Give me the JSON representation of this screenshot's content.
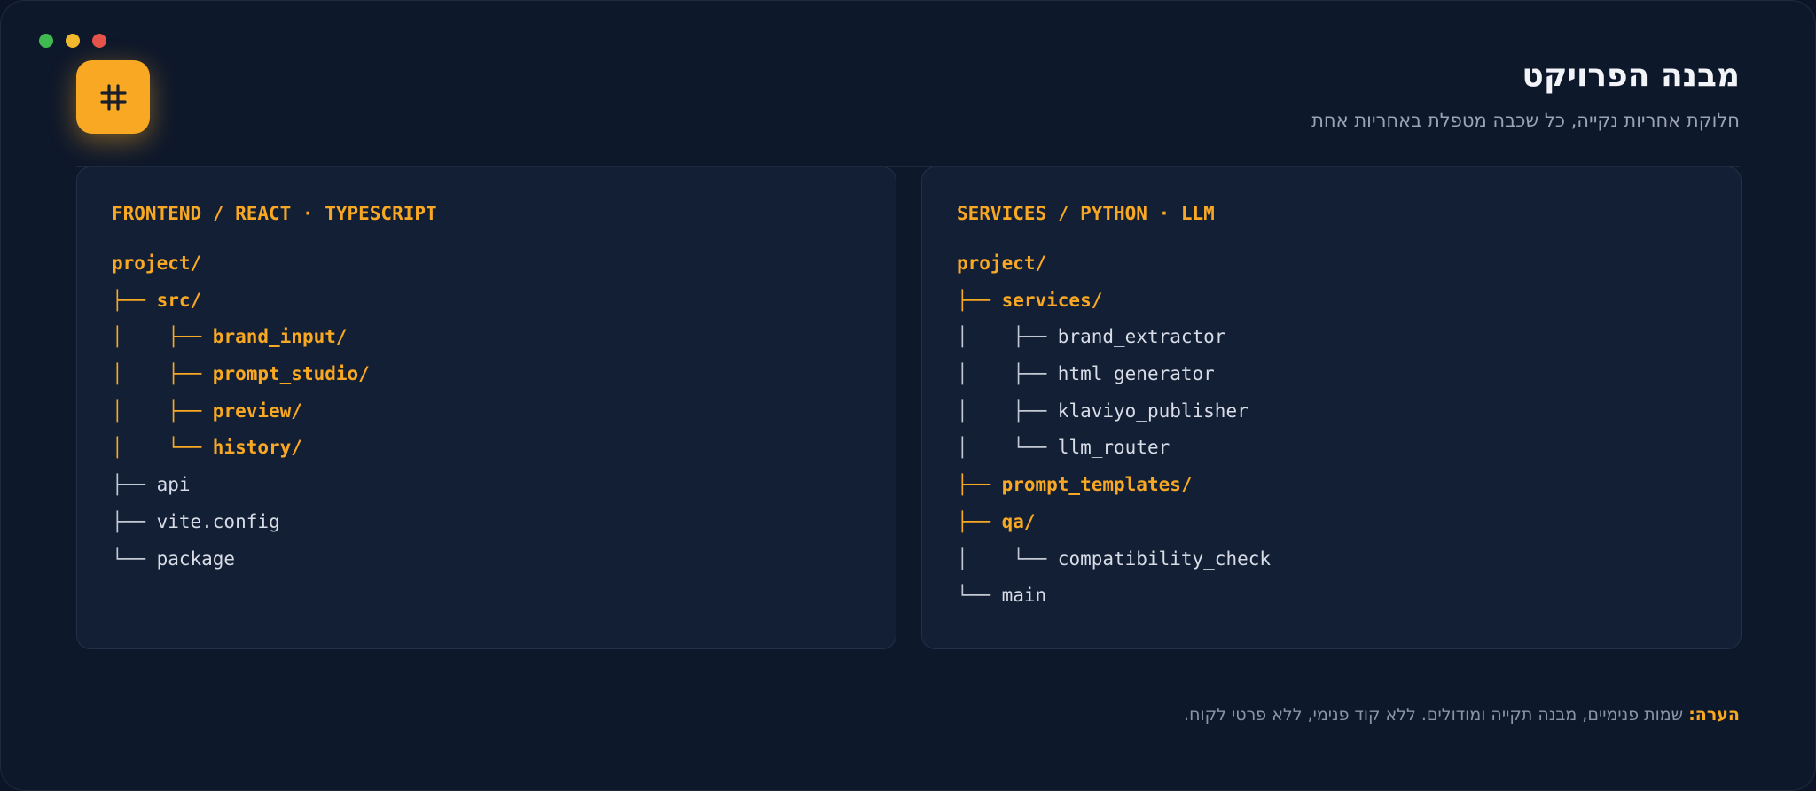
{
  "window": {
    "dot_colors": [
      "#3fb950",
      "#f1b82d",
      "#e5534b"
    ]
  },
  "logo": {
    "icon": "hash-icon",
    "accent": "#f8a823"
  },
  "header": {
    "title": "מבנה הפרויקט",
    "subtitle": "חלוקת אחריות נקייה, כל שכבה מטפלת באחריות אחת"
  },
  "panels": {
    "frontend": {
      "heading": "FRONTEND / REACT · TYPESCRIPT",
      "lines": [
        {
          "prefix": "",
          "name": "project/",
          "kind": "dir"
        },
        {
          "prefix": "├── ",
          "name": "src/",
          "kind": "dir"
        },
        {
          "prefix": "│    ├── ",
          "name": "brand_input/",
          "kind": "dir"
        },
        {
          "prefix": "│    ├── ",
          "name": "prompt_studio/",
          "kind": "dir"
        },
        {
          "prefix": "│    ├── ",
          "name": "preview/",
          "kind": "dir"
        },
        {
          "prefix": "│    └── ",
          "name": "history/",
          "kind": "dir"
        },
        {
          "prefix": "├── ",
          "name": "api",
          "kind": "file"
        },
        {
          "prefix": "├── ",
          "name": "vite.config",
          "kind": "file"
        },
        {
          "prefix": "└── ",
          "name": "package",
          "kind": "file"
        }
      ]
    },
    "services": {
      "heading": "SERVICES / PYTHON · LLM",
      "lines": [
        {
          "prefix": "",
          "name": "project/",
          "kind": "dir"
        },
        {
          "prefix": "├── ",
          "name": "services/",
          "kind": "dir"
        },
        {
          "prefix": "│    ├── ",
          "name": "brand_extractor",
          "kind": "file"
        },
        {
          "prefix": "│    ├── ",
          "name": "html_generator",
          "kind": "file"
        },
        {
          "prefix": "│    ├── ",
          "name": "klaviyo_publisher",
          "kind": "file"
        },
        {
          "prefix": "│    └── ",
          "name": "llm_router",
          "kind": "file"
        },
        {
          "prefix": "├── ",
          "name": "prompt_templates/",
          "kind": "dir"
        },
        {
          "prefix": "├── ",
          "name": "qa/",
          "kind": "dir"
        },
        {
          "prefix": "│    └── ",
          "name": "compatibility_check",
          "kind": "file"
        },
        {
          "prefix": "└── ",
          "name": "main",
          "kind": "file"
        }
      ]
    }
  },
  "footer": {
    "note_label": "הערה:",
    "note_text": " שמות פנימיים, מבנה תקייה ומודולים. ללא קוד פנימי, ללא פרטי לקוח."
  }
}
